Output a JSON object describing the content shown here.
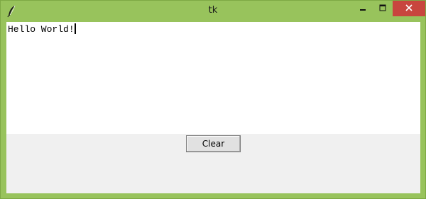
{
  "window": {
    "title": "tk",
    "accent_color": "#98c35c",
    "close_color": "#c8453e",
    "icons": {
      "app": "feather-icon",
      "minimize": "minimize-icon",
      "maximize": "maximize-icon",
      "close": "close-icon"
    }
  },
  "editor": {
    "text": "Hello World!"
  },
  "buttons": {
    "clear_label": "Clear"
  }
}
